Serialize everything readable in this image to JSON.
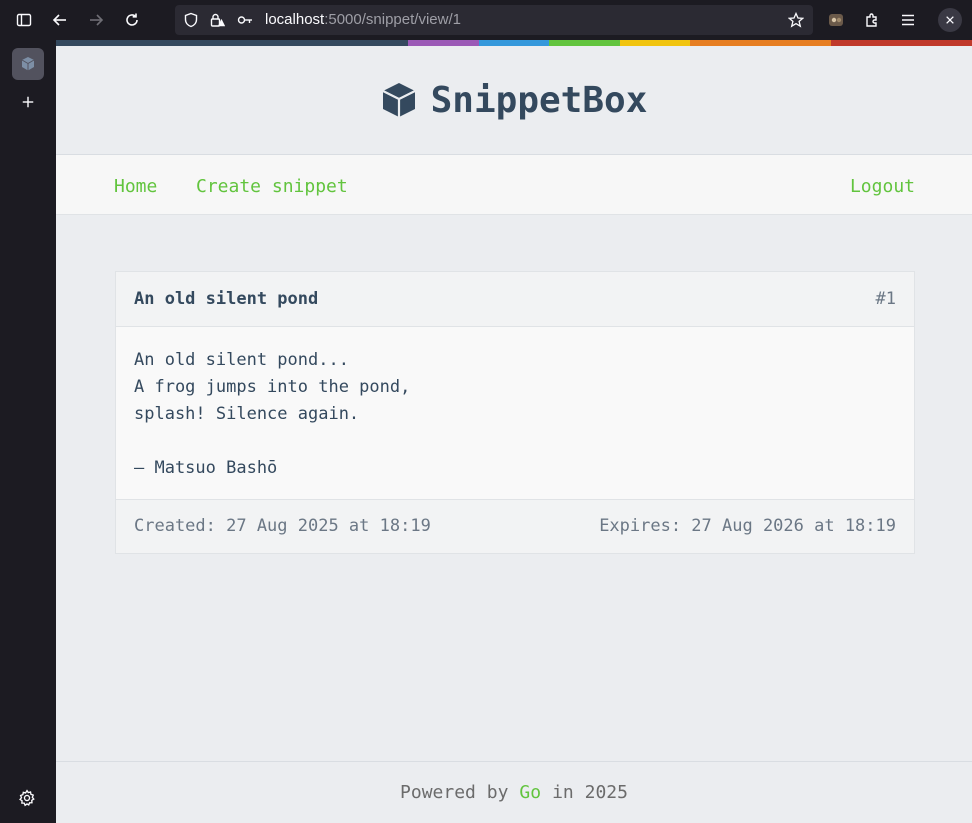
{
  "browser": {
    "url_host": "localhost",
    "url_path": ":5000/snippet/view/1"
  },
  "site": {
    "title": "SnippetBox",
    "stripe_colors": [
      "#34495e",
      "#34495e",
      "#34495e",
      "#34495e",
      "#34495e",
      "#9b59b6",
      "#3498db",
      "#62c43e",
      "#f1c40f",
      "#e67e22",
      "#e67e22",
      "#c0392b",
      "#c0392b"
    ],
    "nav": {
      "home": "Home",
      "create": "Create snippet",
      "logout": "Logout"
    },
    "accent_color": "#62c43e"
  },
  "snippet": {
    "title": "An old silent pond",
    "id_label": "#1",
    "content": "An old silent pond...\nA frog jumps into the pond,\nsplash! Silence again.\n\n– Matsuo Bashō",
    "created": "Created: 27 Aug 2025 at 18:19",
    "expires": "Expires: 27 Aug 2026 at 18:19"
  },
  "footer": {
    "prefix": "Powered by",
    "link": "Go",
    "suffix": "in 2025"
  }
}
